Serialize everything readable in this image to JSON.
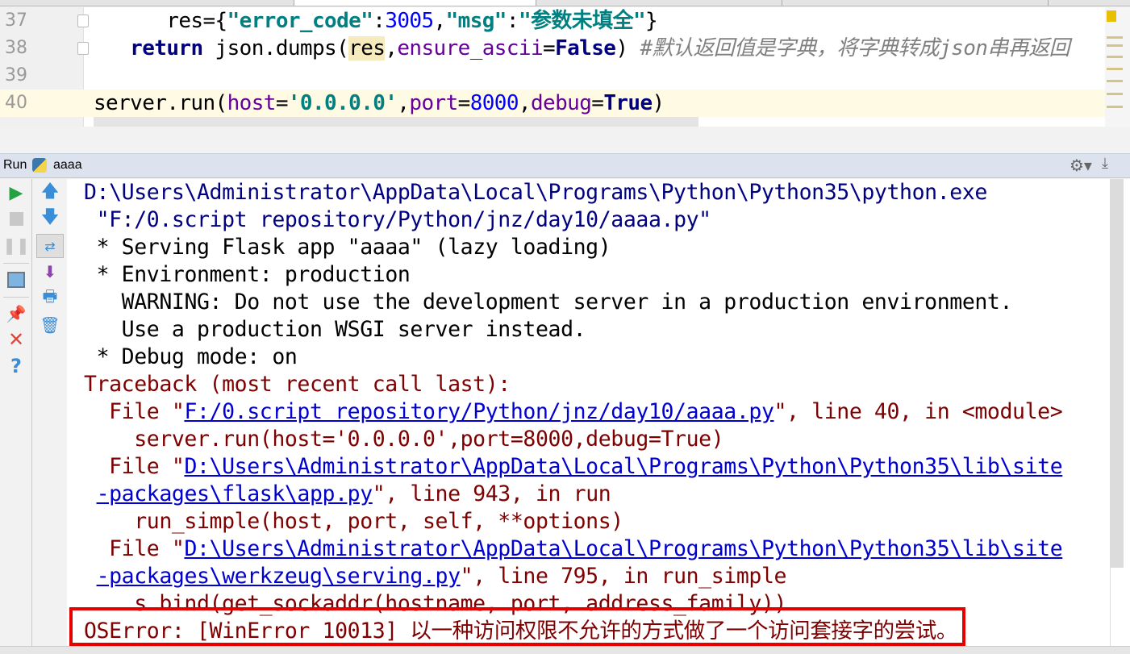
{
  "editor": {
    "lines": [
      {
        "number": "37",
        "indent": "      ",
        "segments": [
          [
            "std",
            "res={"
          ],
          [
            "str",
            "\"error_code\""
          ],
          [
            "std",
            ":"
          ],
          [
            "num",
            "3005"
          ],
          [
            "std",
            ","
          ],
          [
            "str",
            "\"msg\""
          ],
          [
            "std",
            ":"
          ],
          [
            "str",
            "\"参数未填全\""
          ],
          [
            "std",
            "}"
          ]
        ]
      },
      {
        "number": "38",
        "indent": "   ",
        "segments": [
          [
            "kw",
            "return"
          ],
          [
            "std",
            " json.dumps("
          ],
          [
            "hl",
            "res"
          ],
          [
            "std",
            ","
          ],
          [
            "param",
            "ensure_ascii"
          ],
          [
            "std",
            "="
          ],
          [
            "kw",
            "False"
          ],
          [
            "std",
            ") "
          ],
          [
            "cmt",
            "#默认返回值是字典，将字典转成json串再返回"
          ]
        ]
      },
      {
        "number": "39",
        "indent": "",
        "segments": []
      },
      {
        "number": "40",
        "indent": "",
        "segments": [
          [
            "std",
            "server.run("
          ],
          [
            "param",
            "host"
          ],
          [
            "std",
            "="
          ],
          [
            "str",
            "'0.0.0.0'"
          ],
          [
            "std",
            ","
          ],
          [
            "param",
            "port"
          ],
          [
            "std",
            "="
          ],
          [
            "num",
            "8000"
          ],
          [
            "std",
            ","
          ],
          [
            "param",
            "debug"
          ],
          [
            "std",
            "="
          ],
          [
            "kw",
            "True"
          ],
          [
            "std",
            ")"
          ]
        ]
      }
    ]
  },
  "run_panel": {
    "label": "Run",
    "config_name": "aaaa",
    "icons": {
      "settings": "gear-icon",
      "hide": "download-icon"
    }
  },
  "toolbar_left": [
    "run-icon",
    "stop-icon",
    "pause-icon",
    "layout-icon",
    "pin-icon",
    "close-icon",
    "help-icon"
  ],
  "toolbar_right": [
    "up-arrow-icon",
    "down-arrow-icon",
    "soft-wrap-icon",
    "scroll-to-end-icon",
    "print-icon",
    "trash-icon"
  ],
  "console": {
    "lines": [
      {
        "indent": "",
        "segments": [
          [
            "out",
            "D:\\Users\\Administrator\\AppData\\Local\\Programs\\Python\\Python35\\python.exe"
          ]
        ]
      },
      {
        "indent": " ",
        "segments": [
          [
            "out",
            "\"F:/0.script repository/Python/jnz/day10/aaaa.py\""
          ]
        ]
      },
      {
        "indent": " ",
        "segments": [
          [
            "std",
            "* Serving Flask app \"aaaa\" (lazy loading)"
          ]
        ]
      },
      {
        "indent": " ",
        "segments": [
          [
            "std",
            "* Environment: production"
          ]
        ]
      },
      {
        "indent": "   ",
        "segments": [
          [
            "std",
            "WARNING: Do not use the development server in a production environment."
          ]
        ]
      },
      {
        "indent": "   ",
        "segments": [
          [
            "std",
            "Use a production WSGI server instead."
          ]
        ]
      },
      {
        "indent": " ",
        "segments": [
          [
            "std",
            "* Debug mode: on"
          ]
        ]
      },
      {
        "indent": "",
        "segments": [
          [
            "err",
            "Traceback (most recent call last):"
          ]
        ]
      },
      {
        "indent": "  ",
        "segments": [
          [
            "err",
            "File \""
          ],
          [
            "link",
            "F:/0.script repository/Python/jnz/day10/aaaa.py"
          ],
          [
            "err",
            "\", line 40, in <module>"
          ]
        ]
      },
      {
        "indent": "    ",
        "segments": [
          [
            "err",
            "server.run(host='0.0.0.0',port=8000,debug=True)"
          ]
        ]
      },
      {
        "indent": "  ",
        "segments": [
          [
            "err",
            "File \""
          ],
          [
            "link",
            "D:\\Users\\Administrator\\AppData\\Local\\Programs\\Python\\Python35\\lib\\site"
          ]
        ]
      },
      {
        "indent": " ",
        "segments": [
          [
            "link",
            "-packages\\flask\\app.py"
          ],
          [
            "err",
            "\", line 943, in run"
          ]
        ]
      },
      {
        "indent": "    ",
        "segments": [
          [
            "err",
            "run_simple(host, port, self, **options)"
          ]
        ]
      },
      {
        "indent": "  ",
        "segments": [
          [
            "err",
            "File \""
          ],
          [
            "link",
            "D:\\Users\\Administrator\\AppData\\Local\\Programs\\Python\\Python35\\lib\\site"
          ]
        ]
      },
      {
        "indent": " ",
        "segments": [
          [
            "link",
            "-packages\\werkzeug\\serving.py"
          ],
          [
            "err",
            "\", line 795, in run_simple"
          ]
        ]
      },
      {
        "indent": "    ",
        "segments": [
          [
            "err",
            "s.bind(get_sockaddr(hostname, port, address_family))"
          ]
        ]
      },
      {
        "indent": "",
        "segments": [
          [
            "err",
            "OSError: [WinError 10013] 以一种访问权限不允许的方式做了一个访问套接字的尝试。"
          ]
        ]
      }
    ]
  },
  "colors": {
    "highlight_box": "#e60000",
    "stdout": "#000080",
    "stderr": "#7f0000",
    "link": "#0000d0"
  }
}
